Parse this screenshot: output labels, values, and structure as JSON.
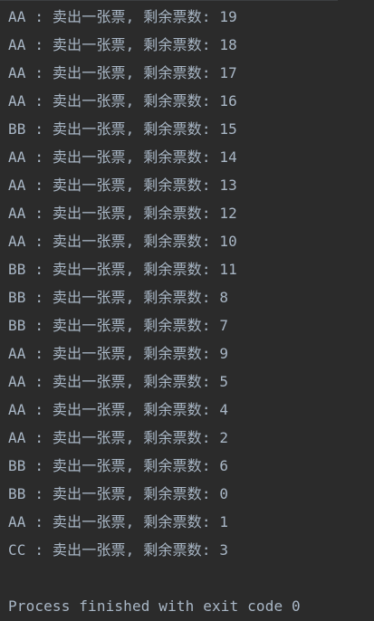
{
  "console": {
    "lines": [
      "AA : 卖出一张票, 剩余票数: 19",
      "AA : 卖出一张票, 剩余票数: 18",
      "AA : 卖出一张票, 剩余票数: 17",
      "AA : 卖出一张票, 剩余票数: 16",
      "BB : 卖出一张票, 剩余票数: 15",
      "AA : 卖出一张票, 剩余票数: 14",
      "AA : 卖出一张票, 剩余票数: 13",
      "AA : 卖出一张票, 剩余票数: 12",
      "AA : 卖出一张票, 剩余票数: 10",
      "BB : 卖出一张票, 剩余票数: 11",
      "BB : 卖出一张票, 剩余票数: 8",
      "BB : 卖出一张票, 剩余票数: 7",
      "AA : 卖出一张票, 剩余票数: 9",
      "AA : 卖出一张票, 剩余票数: 5",
      "AA : 卖出一张票, 剩余票数: 4",
      "AA : 卖出一张票, 剩余票数: 2",
      "BB : 卖出一张票, 剩余票数: 6",
      "BB : 卖出一张票, 剩余票数: 0",
      "AA : 卖出一张票, 剩余票数: 1",
      "CC : 卖出一张票, 剩余票数: 3"
    ],
    "exit_message": "Process finished with exit code 0"
  }
}
